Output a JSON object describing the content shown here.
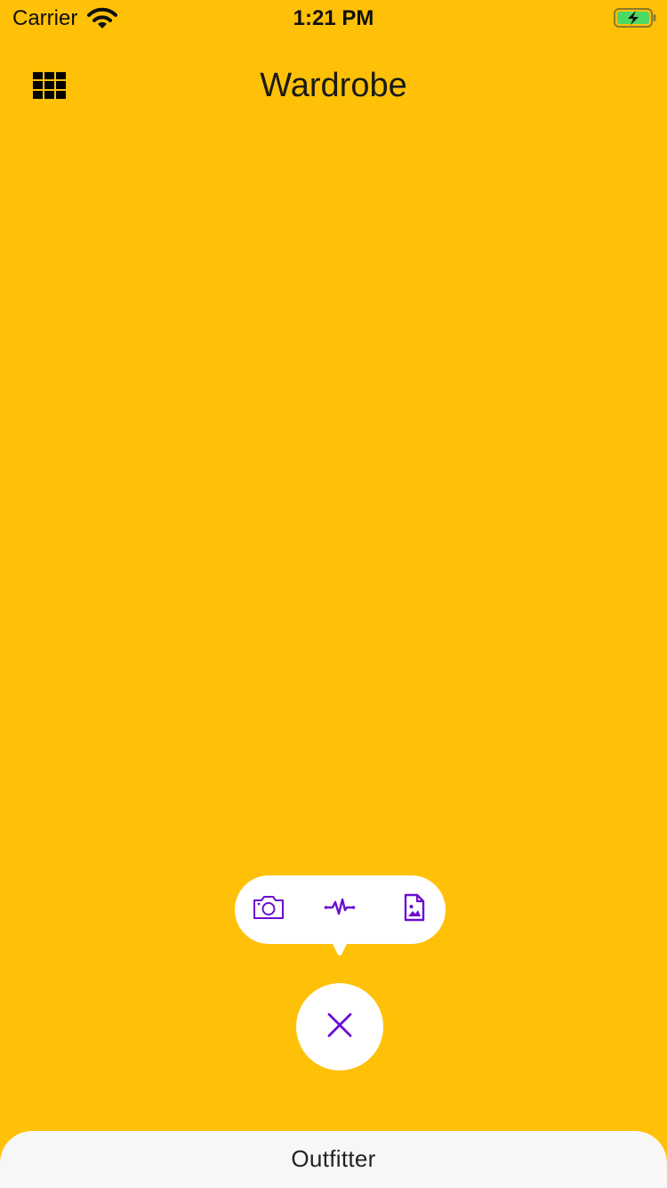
{
  "status_bar": {
    "carrier": "Carrier",
    "time": "1:21 PM",
    "icons": [
      "wifi-icon",
      "battery-charging-icon"
    ]
  },
  "header": {
    "title": "Wardrobe",
    "left_icon": "grid-icon"
  },
  "action_menu": {
    "items": [
      {
        "icon": "camera-icon"
      },
      {
        "icon": "waveform-icon"
      },
      {
        "icon": "image-file-icon"
      }
    ],
    "close_icon": "close-icon"
  },
  "tab_bar": {
    "label": "Outfitter"
  },
  "colors": {
    "background": "#FFC107",
    "accent": "#6A0DD1",
    "surface": "#FFFFFF",
    "tab_bar": "#F7F7F7",
    "battery_fill": "#4CD964"
  }
}
